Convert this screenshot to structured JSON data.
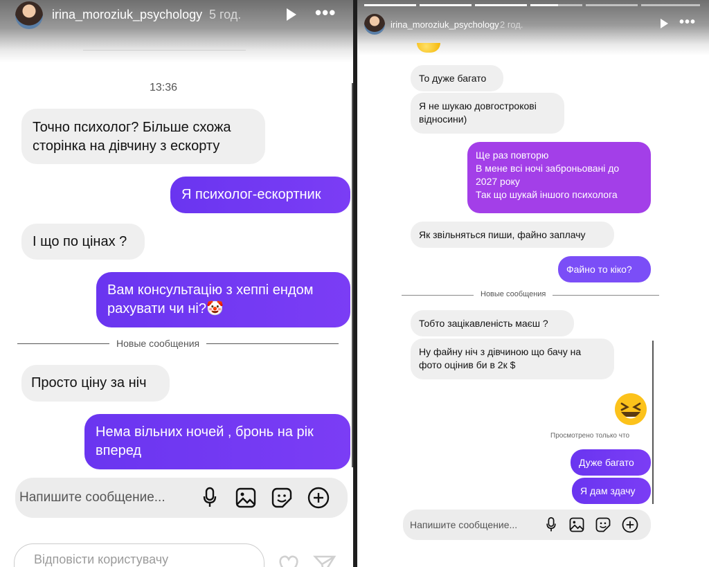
{
  "left": {
    "header": {
      "username": "irina_moroziuk_psychology",
      "time": "5 год."
    },
    "timestamp": "13:36",
    "messages": [
      {
        "text": "Точно психолог? Більше схожа сторінка на дівчину з ескорту"
      },
      {
        "text": "Я психолог-ескортник"
      },
      {
        "text": "І що по цінах ?"
      },
      {
        "text": "Вам консультацію з хеппі ендом рахувати чи ні?🤡"
      },
      {
        "text": "Просто ціну за ніч"
      },
      {
        "text": "Нема вільних ночей , бронь на рік вперед"
      }
    ],
    "divider_label": "Новые сообщения",
    "composer_placeholder": "Напишите сообщение...",
    "reply_placeholder": "Відповісти користувачу"
  },
  "right": {
    "header": {
      "username": "irina_moroziuk_psychology",
      "time": "2 год."
    },
    "messages": [
      {
        "text": "То дуже багато"
      },
      {
        "text": "Я не шукаю довгострокові відносини)"
      },
      {
        "lines": [
          "Ще раз повторю",
          "В мене всі ночі заброньовані до 2027 року",
          "Так що шукай іншого психолога"
        ]
      },
      {
        "text": "Як звільняться пиши, файно заплачу"
      },
      {
        "text": "Файно то кіко?"
      },
      {
        "text": "Тобто зацікавленість маєш ?"
      },
      {
        "text": "Ну файну ніч з дівчиною що бачу на фото оцінив би в 2к $"
      },
      {
        "text": "Дуже багато"
      },
      {
        "text": "Я дам здачу"
      }
    ],
    "divider_label": "Новые сообщения",
    "seen_label": "Просмотрено только что",
    "composer_placeholder": "Напишите сообщение..."
  },
  "colors": {
    "outgoing_blue": "#6a35f0",
    "outgoing_purple": "#a33fe8",
    "incoming_gray": "#efefef"
  },
  "icons": [
    "play-icon",
    "more-icon",
    "mic-icon",
    "image-icon",
    "sticker-icon",
    "plus-icon",
    "heart-icon",
    "send-icon"
  ]
}
